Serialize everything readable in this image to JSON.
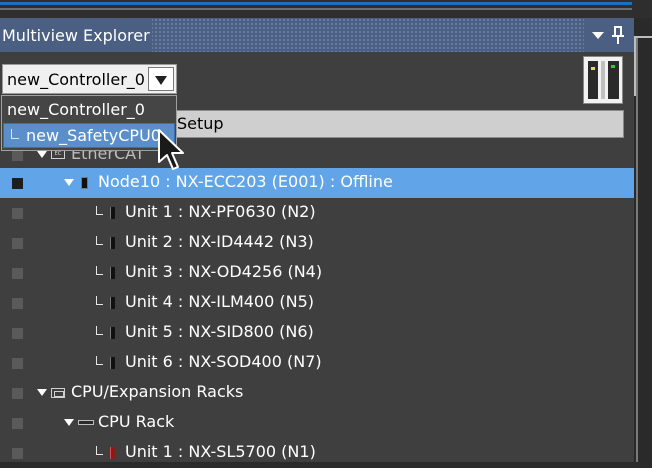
{
  "panel": {
    "title": "Multiview Explorer"
  },
  "controller_select": {
    "value": "new_Controller_0",
    "options": [
      "new_Controller_0",
      "new_SafetyCPU0"
    ],
    "highlighted_option": "new_SafetyCPU0"
  },
  "setup_bar": {
    "label": "Setup"
  },
  "tree": [
    {
      "label": "EtherCAT",
      "icon": "ethercat-icon",
      "expanded": true
    },
    {
      "label": "Node10 : NX-ECC203 (E001) : Offline",
      "icon": "node-icon",
      "expanded": true,
      "selected": true
    },
    {
      "label": "Unit 1 : NX-PF0630 (N2)",
      "icon": "unit-icon"
    },
    {
      "label": "Unit 2 : NX-ID4442 (N3)",
      "icon": "unit-icon"
    },
    {
      "label": "Unit 3 : NX-OD4256 (N4)",
      "icon": "unit-icon"
    },
    {
      "label": "Unit 4 : NX-ILM400 (N5)",
      "icon": "unit-icon"
    },
    {
      "label": "Unit 5 : NX-SID800 (N6)",
      "icon": "unit-icon"
    },
    {
      "label": "Unit 6 : NX-SOD400 (N7)",
      "icon": "unit-icon"
    },
    {
      "label": "CPU/Expansion Racks",
      "icon": "rack-icon",
      "expanded": true
    },
    {
      "label": "CPU Rack",
      "icon": "cpu-rack-icon",
      "expanded": true
    },
    {
      "label": "Unit 1 : NX-SL5700 (N1)",
      "icon": "unit-icon-red"
    }
  ],
  "colors": {
    "title_bar": "#4a5f82",
    "selection": "#61a5e8",
    "panel_bg": "#3f3f3f",
    "dropdown_highlight": "#5b8fc9"
  }
}
